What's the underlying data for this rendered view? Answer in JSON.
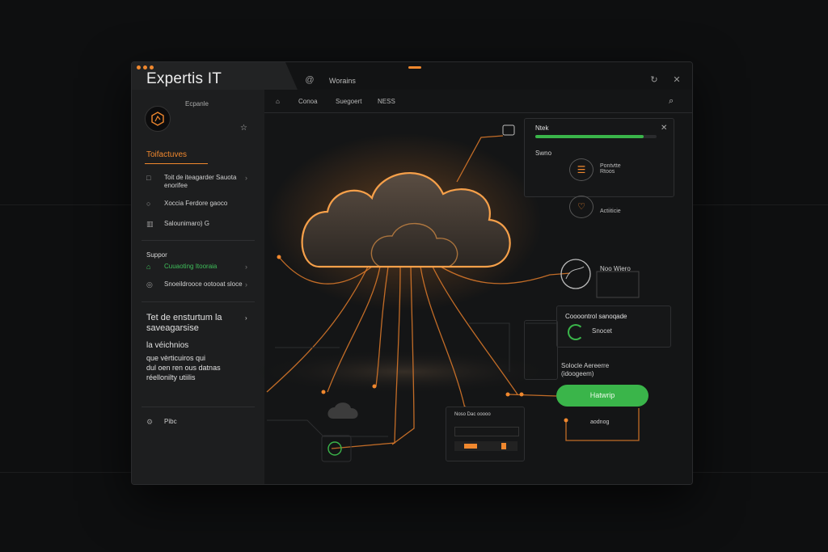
{
  "window": {
    "brand": "Expertis IT",
    "tab_label": "Worains"
  },
  "sidebar": {
    "profile_name": "Ecpanle",
    "section1_title": "Toifactuves",
    "items": [
      {
        "label": "Toit de iteagarder Sauota enorifee",
        "icon": "document-icon"
      },
      {
        "label": "Xoccia Ferdore  gaoco",
        "icon": "chat-icon"
      },
      {
        "label": "Salounimaro) G",
        "icon": "chart-icon"
      }
    ],
    "section2_title": "Suppor",
    "support_items": [
      {
        "label": "Cuuaoting Itooraia",
        "icon": "headset-icon"
      },
      {
        "label": "Snoeildrooce ootooat sloce",
        "icon": "bell-icon"
      }
    ],
    "big_item": "Tet de ensturtum la saveagarsise",
    "paragraph": [
      "la véichnios",
      "que vèrticuiros qui",
      "dul oen ren ous datnas",
      "réellonilty utiilis"
    ],
    "footer_item": "Pibc"
  },
  "nav": {
    "items": [
      "Conoa",
      "Suegoert",
      "NESS"
    ]
  },
  "panels": {
    "top_right_title": "Ntek",
    "progress_fraction": 0.89,
    "top_right_label": "Swno",
    "items": [
      {
        "label": "Pontvtte Rtoos",
        "icon": "clipboard-icon"
      },
      {
        "label": "Actiiticie",
        "icon": "heart-icon"
      }
    ],
    "gauge_label": "Noo Wiero",
    "status_title": "Coooontrol sanoqade",
    "status_value": "Snocet",
    "process_label": "Solocle Aereerre (idoogeem)",
    "button_label": "Hatwrip",
    "below_button": "aodnog",
    "mini_card_title": "Noso Dac ooooo"
  },
  "colors": {
    "accent": "#f0882e",
    "success": "#3ab54a",
    "window_bg": "#161718",
    "sidebar_bg": "#1d1e1f"
  }
}
